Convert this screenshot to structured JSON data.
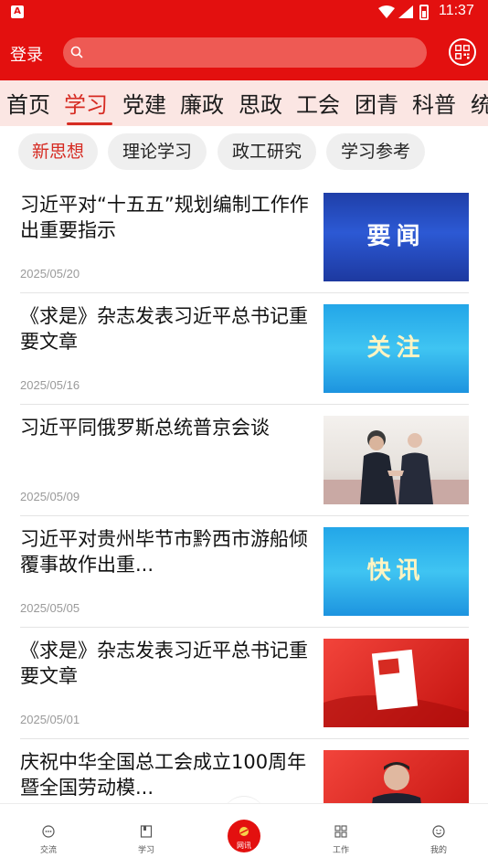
{
  "status_bar": {
    "time": "11:37",
    "app_icon_glyph": "A"
  },
  "header": {
    "login_label": "登录",
    "search_placeholder": "",
    "qr_icon": "qr-code-icon",
    "accent_color": "#e3100f"
  },
  "tabs": [
    {
      "label": "首页",
      "active": false
    },
    {
      "label": "学习",
      "active": true
    },
    {
      "label": "党建",
      "active": false
    },
    {
      "label": "廉政",
      "active": false
    },
    {
      "label": "思政",
      "active": false
    },
    {
      "label": "工会",
      "active": false
    },
    {
      "label": "团青",
      "active": false
    },
    {
      "label": "科普",
      "active": false
    },
    {
      "label": "统",
      "active": false
    }
  ],
  "chips": [
    {
      "label": "新思想",
      "active": true
    },
    {
      "label": "理论学习",
      "active": false
    },
    {
      "label": "政工研究",
      "active": false
    },
    {
      "label": "学习参考",
      "active": false
    }
  ],
  "news": [
    {
      "title": "习近平对“十五五”规划编制工作作出重要指示",
      "date": "2025/05/20",
      "thumb_text": "要闻"
    },
    {
      "title": "《求是》杂志发表习近平总书记重要文章",
      "date": "2025/05/16",
      "thumb_text": "关注"
    },
    {
      "title": "习近平同俄罗斯总统普京会谈",
      "date": "2025/05/09",
      "thumb_text": ""
    },
    {
      "title": "习近平对贵州毕节市黔西市游船倾覆事故作出重...",
      "date": "2025/05/05",
      "thumb_text": "快讯"
    },
    {
      "title": "《求是》杂志发表习近平总书记重要文章",
      "date": "2025/05/01",
      "thumb_text": ""
    },
    {
      "title": "庆祝中华全国总工会成立100周年暨全国劳动模...",
      "date": "",
      "thumb_text": ""
    }
  ],
  "bottom_nav": [
    {
      "label": "交流",
      "icon": "chat-icon"
    },
    {
      "label": "学习",
      "icon": "book-icon"
    },
    {
      "label": "网讯",
      "icon": "party-emblem-icon"
    },
    {
      "label": "工作",
      "icon": "grid-icon"
    },
    {
      "label": "我的",
      "icon": "smiley-icon"
    }
  ]
}
